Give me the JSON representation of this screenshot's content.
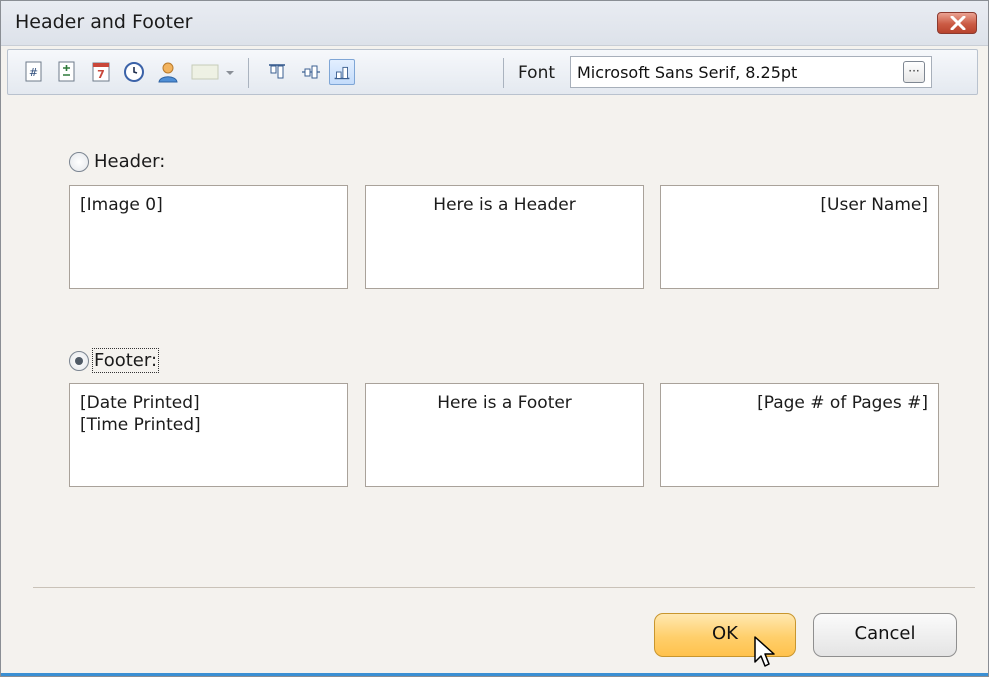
{
  "window": {
    "title": "Header and Footer",
    "close_icon": "close-icon"
  },
  "toolbar": {
    "buttons": [
      {
        "icon": "page-number-icon"
      },
      {
        "icon": "page-of-pages-icon"
      },
      {
        "icon": "date-icon"
      },
      {
        "icon": "time-icon"
      },
      {
        "icon": "user-icon"
      },
      {
        "icon": "image-dropdown-icon"
      },
      {
        "icon": "align-top-icon"
      },
      {
        "icon": "align-middle-icon"
      },
      {
        "icon": "align-bottom-icon",
        "active": true
      }
    ],
    "font_label": "Font",
    "font_value": "Microsoft Sans Serif, 8.25pt",
    "font_dots": "···"
  },
  "header": {
    "label": "Header:",
    "selected": false,
    "left": [
      "[Image 0]"
    ],
    "center": [
      "Here is a Header"
    ],
    "right": [
      "[User Name]"
    ]
  },
  "footer": {
    "label": "Footer:",
    "selected": true,
    "left": [
      "[Date Printed]",
      "[Time Printed]"
    ],
    "center": [
      "Here is a Footer"
    ],
    "right": [
      "[Page # of Pages #]"
    ]
  },
  "buttons": {
    "ok": "OK",
    "cancel": "Cancel"
  },
  "colors": {
    "ok_button": "#ffc24d",
    "window_bg": "#f4f2ee",
    "toolbar_active": "#c4dcfb"
  }
}
